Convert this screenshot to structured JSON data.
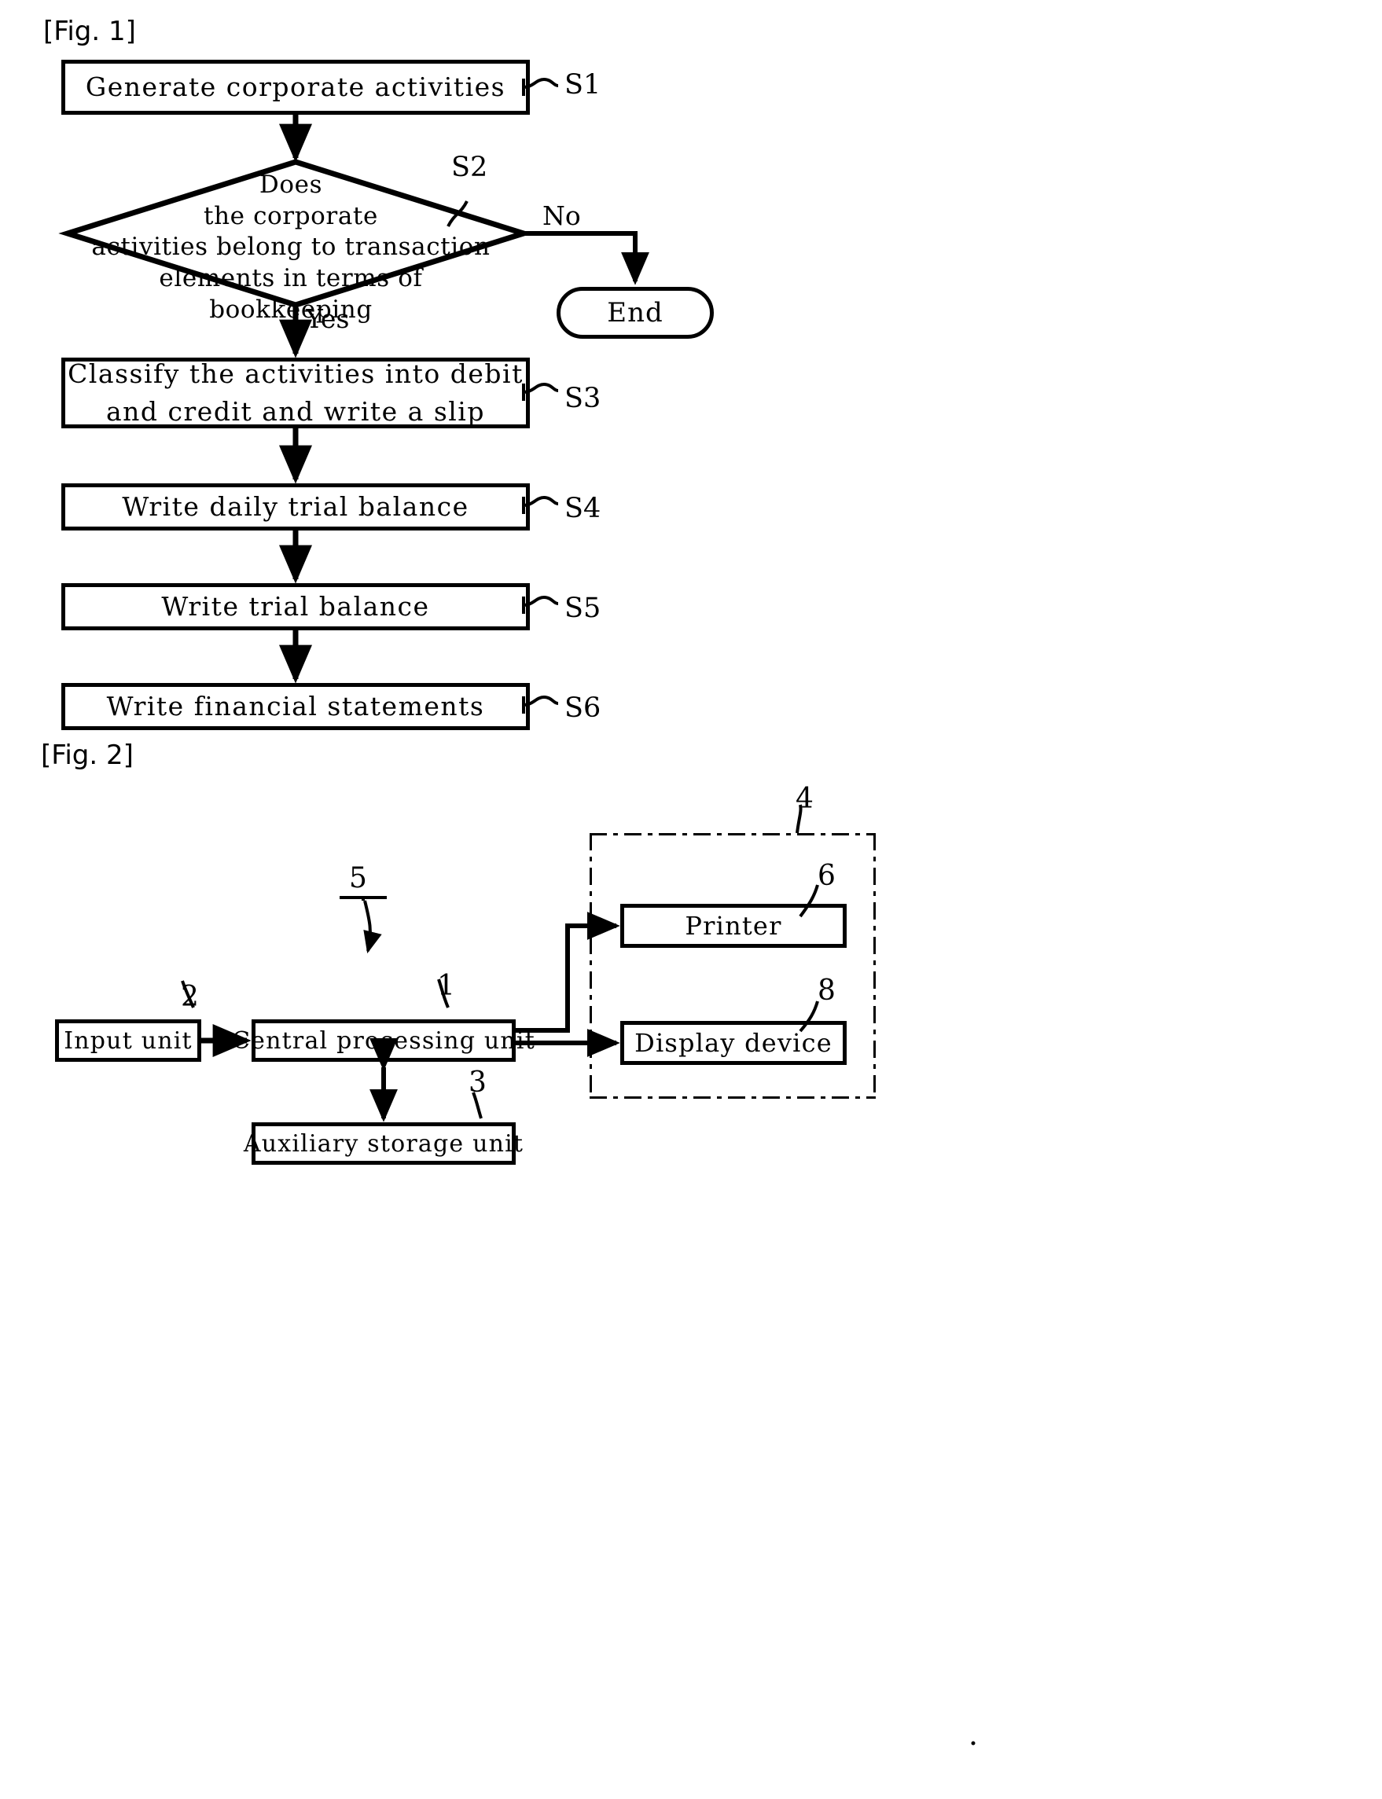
{
  "figures": [
    {
      "label": "[Fig. 1]",
      "type": "flowchart",
      "steps": [
        {
          "tag": "S1",
          "text": "Generate corporate activities",
          "shape": "process"
        },
        {
          "tag": "S2",
          "text": "Does the corporate activities belong to transaction elements in terms of bookkeeping",
          "shape": "decision"
        },
        {
          "tag": "S3",
          "text": "Classify the activities into debit and credit and write a slip",
          "shape": "process"
        },
        {
          "tag": "S4",
          "text": "Write daily trial balance",
          "shape": "process"
        },
        {
          "tag": "S5",
          "text": "Write trial balance",
          "shape": "process"
        },
        {
          "tag": "S6",
          "text": "Write financial statements",
          "shape": "process"
        }
      ],
      "decision_lines": [
        "Does",
        "the corporate",
        "activities belong to transaction",
        "elements in terms of",
        "bookkeeping"
      ],
      "branch_yes": "Yes",
      "branch_no": "No",
      "terminator": "End"
    },
    {
      "label": "[Fig. 2]",
      "type": "block-diagram",
      "system_ref": "5",
      "blocks": [
        {
          "ref": "2",
          "text": "Input unit"
        },
        {
          "ref": "1",
          "text": "Central processing unit"
        },
        {
          "ref": "3",
          "text": "Auxiliary storage unit"
        },
        {
          "ref": "6",
          "text": "Printer"
        },
        {
          "ref": "8",
          "text": "Display device"
        }
      ],
      "group": {
        "ref": "4",
        "members": [
          "6",
          "8"
        ]
      }
    }
  ],
  "fig1": {
    "label": "[Fig. 1]",
    "s1": {
      "tag": "S1",
      "text": "Generate corporate activities"
    },
    "s2": {
      "tag": "S2",
      "line1": "Does",
      "line2": "the corporate",
      "line3": "activities belong to transaction",
      "line4": "elements in terms of",
      "line5": "bookkeeping"
    },
    "s3": {
      "tag": "S3",
      "line1": "Classify the activities into debit",
      "line2": "and credit and write a slip"
    },
    "s4": {
      "tag": "S4",
      "text": "Write daily trial balance"
    },
    "s5": {
      "tag": "S5",
      "text": "Write trial balance"
    },
    "s6": {
      "tag": "S6",
      "text": "Write financial statements"
    },
    "yes": "Yes",
    "no": "No",
    "end": "End"
  },
  "fig2": {
    "label": "[Fig. 2]",
    "ref_system": "5",
    "ref_input": "2",
    "ref_cpu": "1",
    "ref_storage": "3",
    "ref_group": "4",
    "ref_printer": "6",
    "ref_display": "8",
    "input_unit": "Input unit",
    "cpu": "Central processing unit",
    "storage": "Auxiliary storage unit",
    "printer": "Printer",
    "display": "Display device"
  },
  "colors": {
    "ink": "#000000",
    "paper": "#ffffff"
  }
}
